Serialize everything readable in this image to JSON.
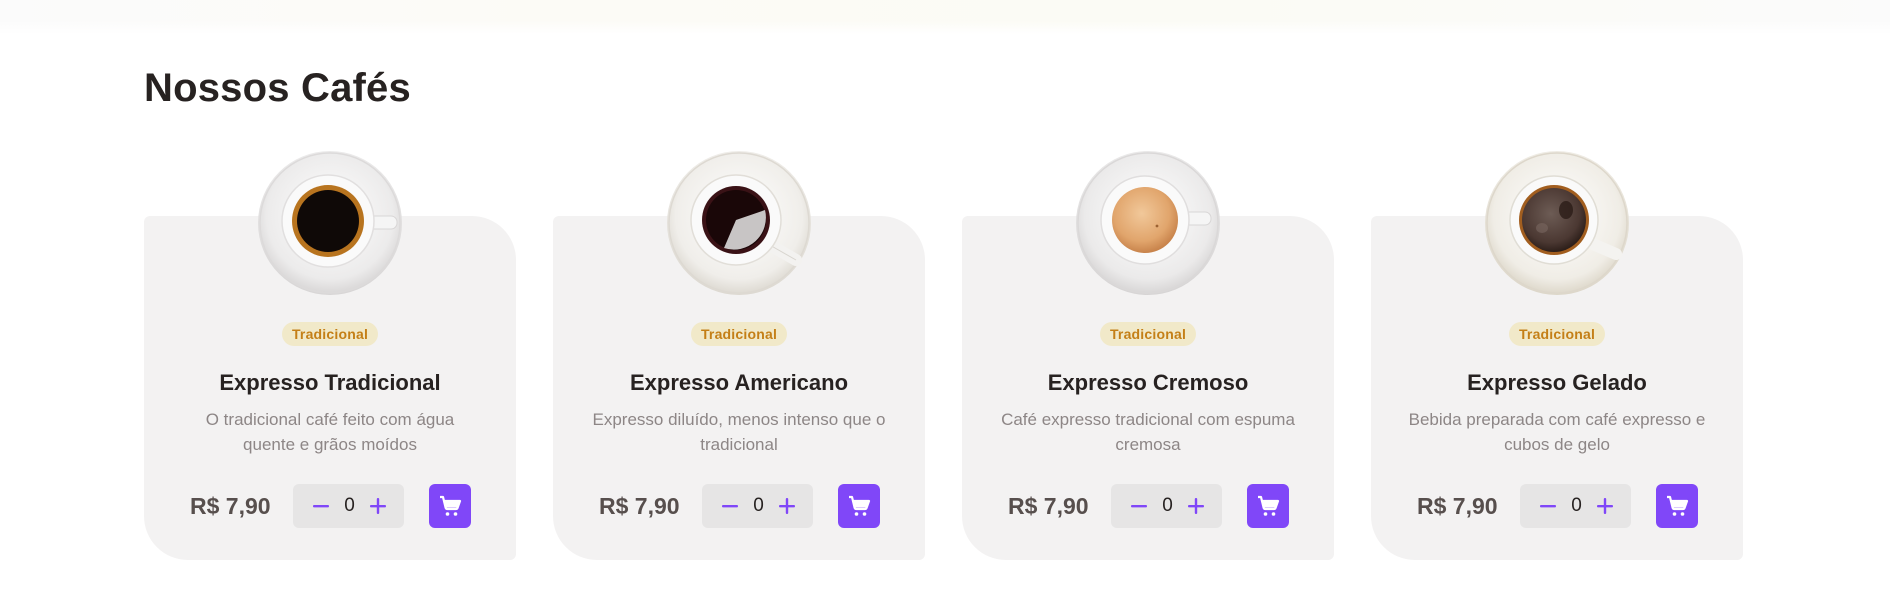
{
  "section": {
    "title": "Nossos Cafés"
  },
  "colors": {
    "accent": "#8047f8",
    "tag_bg": "#f1e9c9",
    "tag_text": "#c47f17",
    "card_bg": "#f3f2f2"
  },
  "products": [
    {
      "tag": "Tradicional",
      "name": "Expresso Tradicional",
      "description": "O tradicional café feito com água quente e grãos moídos",
      "price": "R$ 7,90",
      "quantity": "0",
      "image": "expresso-tradicional-cup"
    },
    {
      "tag": "Tradicional",
      "name": "Expresso Americano",
      "description": "Expresso diluído, menos intenso que o tradicional",
      "price": "R$ 7,90",
      "quantity": "0",
      "image": "expresso-americano-cup"
    },
    {
      "tag": "Tradicional",
      "name": "Expresso Cremoso",
      "description": "Café expresso tradicional com espuma cremosa",
      "price": "R$ 7,90",
      "quantity": "0",
      "image": "expresso-cremoso-cup"
    },
    {
      "tag": "Tradicional",
      "name": "Expresso Gelado",
      "description": "Bebida preparada com café expresso e cubos de gelo",
      "price": "R$ 7,90",
      "quantity": "0",
      "image": "expresso-gelado-cup"
    }
  ],
  "icons": {
    "minus": "minus-icon",
    "plus": "plus-icon",
    "cart": "cart-icon"
  }
}
